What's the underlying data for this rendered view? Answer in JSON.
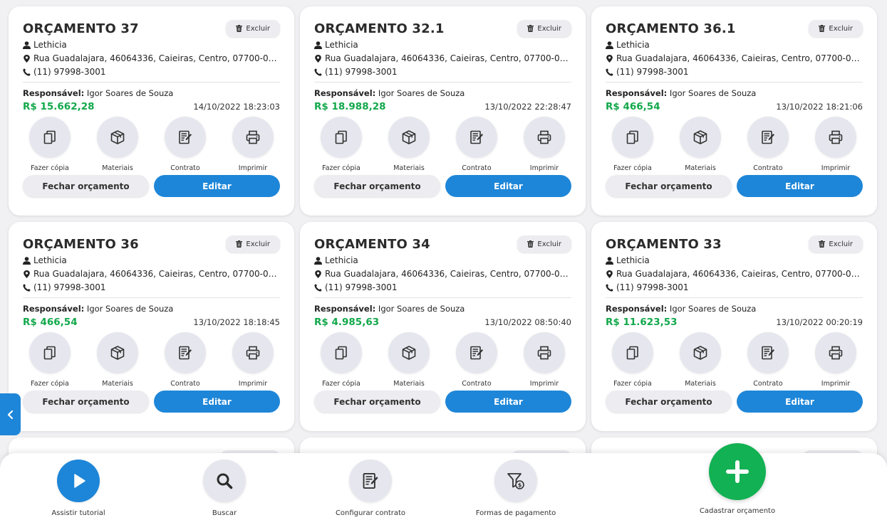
{
  "cards": [
    {
      "title": "ORÇAMENTO 37",
      "client": "Lethicia",
      "address": "Rua Guadalajara, 46064336, Caieiras, Centro, 07700-000...",
      "phone": "(11) 97998-3001",
      "responsible_label": "Responsável:",
      "responsible": "Igor Soares de Souza",
      "price": "R$ 15.662,28",
      "date": "14/10/2022 18:23:03"
    },
    {
      "title": "ORÇAMENTO 32.1",
      "client": "Lethicia",
      "address": "Rua Guadalajara, 46064336, Caieiras, Centro, 07700-000...",
      "phone": "(11) 97998-3001",
      "responsible_label": "Responsável:",
      "responsible": "Igor Soares de Souza",
      "price": "R$ 18.988,28",
      "date": "13/10/2022 22:28:47"
    },
    {
      "title": "ORÇAMENTO 36.1",
      "client": "Lethicia",
      "address": "Rua Guadalajara, 46064336, Caieiras, Centro, 07700-000...",
      "phone": "(11) 97998-3001",
      "responsible_label": "Responsável:",
      "responsible": "Igor Soares de Souza",
      "price": "R$ 466,54",
      "date": "13/10/2022 18:21:06"
    },
    {
      "title": "ORÇAMENTO 36",
      "client": "Lethicia",
      "address": "Rua Guadalajara, 46064336, Caieiras, Centro, 07700-000...",
      "phone": "(11) 97998-3001",
      "responsible_label": "Responsável:",
      "responsible": "Igor Soares de Souza",
      "price": "R$ 466,54",
      "date": "13/10/2022 18:18:45"
    },
    {
      "title": "ORÇAMENTO 34",
      "client": "Lethicia",
      "address": "Rua Guadalajara, 46064336, Caieiras, Centro, 07700-000...",
      "phone": "(11) 97998-3001",
      "responsible_label": "Responsável:",
      "responsible": "Igor Soares de Souza",
      "price": "R$ 4.985,63",
      "date": "13/10/2022 08:50:40"
    },
    {
      "title": "ORÇAMENTO 33",
      "client": "Lethicia",
      "address": "Rua Guadalajara, 46064336, Caieiras, Centro, 07700-000...",
      "phone": "(11) 97998-3001",
      "responsible_label": "Responsável:",
      "responsible": "Igor Soares de Souza",
      "price": "R$ 11.623,53",
      "date": "13/10/2022 00:20:19"
    }
  ],
  "card_labels": {
    "delete": "Excluir",
    "copy": "Fazer cópia",
    "materials": "Materiais",
    "contract": "Contrato",
    "print": "Imprimir",
    "close_budget": "Fechar orçamento",
    "edit": "Editar"
  },
  "bottom_bar": {
    "tutorial": "Assistir tutorial",
    "search": "Buscar",
    "configure_contract": "Configurar contrato",
    "payment_methods": "Formas de pagamento",
    "add_budget": "Cadastrar orçamento"
  },
  "colors": {
    "accent": "#1e86d8",
    "price": "#12a84b",
    "fab": "#12b153"
  },
  "icons": [
    "trash-icon",
    "user-icon",
    "map-marker-icon",
    "phone-icon",
    "copy-icon",
    "box-icon",
    "contract-icon",
    "printer-icon",
    "chevron-left-icon",
    "play-icon",
    "search-icon",
    "filter-money-icon",
    "plus-icon"
  ]
}
